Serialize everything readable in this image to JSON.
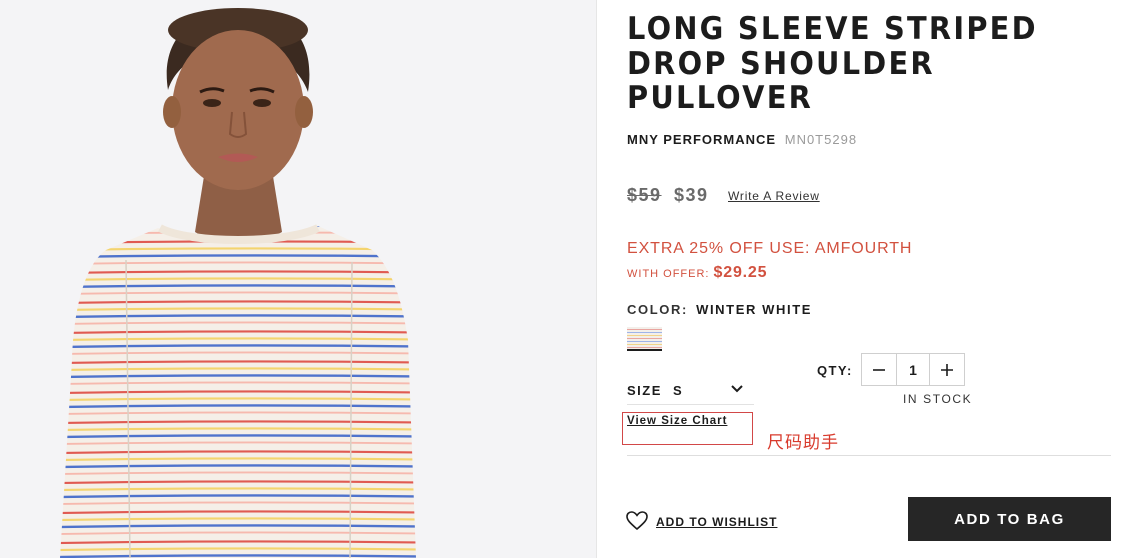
{
  "product": {
    "title": "LONG SLEEVE STRIPED\nDROP SHOULDER\nPULLOVER",
    "brand": "MNY PERFORMANCE",
    "sku": "MN0T5298"
  },
  "pricing": {
    "original": "$59",
    "sale": "$39",
    "write_review": "Write A Review",
    "promo": "EXTRA 25% OFF USE: AMFOURTH",
    "offer_label": "WITH OFFER: ",
    "offer_price": "$29.25",
    "promo_color": "#d2513f"
  },
  "color": {
    "label": "COLOR:",
    "value": "WINTER WHITE"
  },
  "size": {
    "label": "SIZE",
    "value": "S",
    "chart_link": "View Size Chart",
    "helper_annotation": "尺码助手"
  },
  "quantity": {
    "label": "QTY:",
    "value": "1",
    "stock": "IN STOCK"
  },
  "actions": {
    "wishlist": "ADD TO WISHLIST",
    "add_to_bag": "ADD TO BAG"
  },
  "icons": {
    "chevron": "chevron-down-icon",
    "minus": "minus-icon",
    "plus": "plus-icon",
    "heart": "heart-icon"
  }
}
